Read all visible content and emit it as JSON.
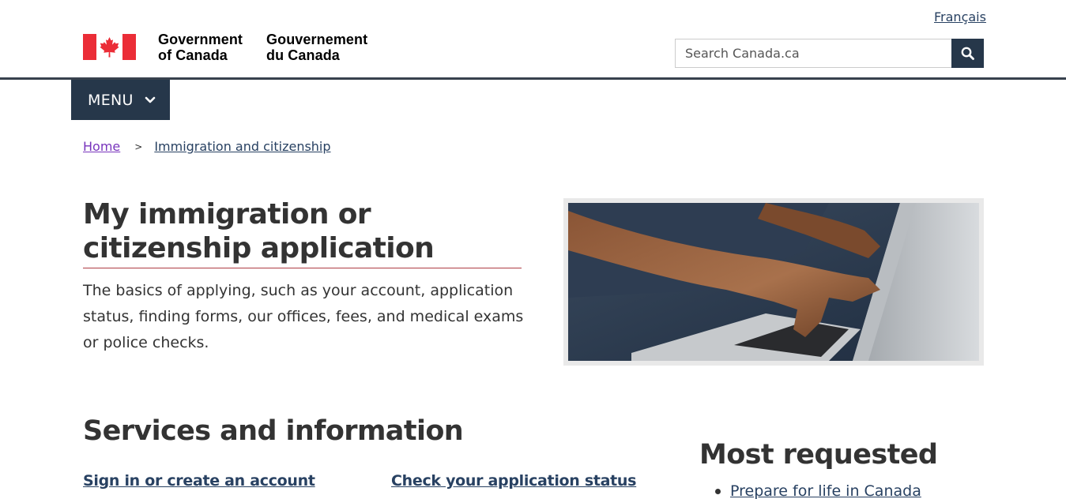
{
  "header": {
    "language_toggle": "Français",
    "gov_en_line1": "Government",
    "gov_en_line2": "of Canada",
    "gov_fr_line1": "Gouvernement",
    "gov_fr_line2": "du Canada",
    "search_placeholder": "Search Canada.ca",
    "search_icon": "search-icon",
    "flag_colors": {
      "red": "#eb2d37",
      "white": "#ffffff"
    }
  },
  "menu": {
    "label": "MENU",
    "icon": "chevron-down-icon"
  },
  "breadcrumb": [
    {
      "label": "Home"
    },
    {
      "label": "Immigration and citizenship"
    }
  ],
  "breadcrumb_separator": ">",
  "page": {
    "title": "My immigration or citizenship application",
    "description": "The basics of applying, such as your account, application status, finding forms, our offices, fees, and medical exams or police checks."
  },
  "services": {
    "title": "Services and information",
    "items": [
      {
        "label": "Sign in or create an account"
      },
      {
        "label": "Check your application status"
      }
    ]
  },
  "most_requested": {
    "title": "Most requested",
    "items": [
      {
        "label": "Prepare for life in Canada"
      }
    ]
  },
  "colors": {
    "brand_dark": "#26374a",
    "link": "#284162",
    "visited_link": "#7834bc",
    "accent_rule": "#af3c43",
    "text": "#333333"
  }
}
